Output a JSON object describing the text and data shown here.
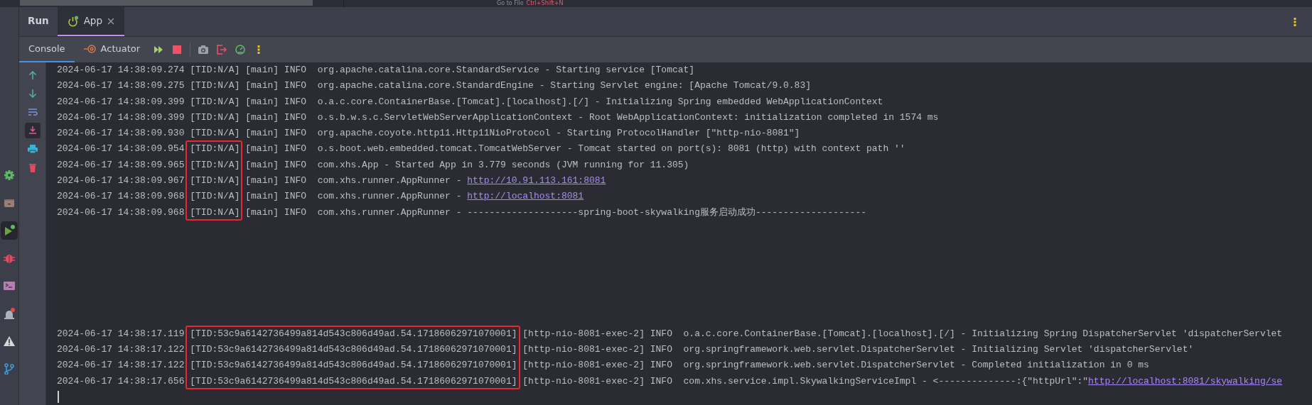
{
  "top_strip": {
    "hint": "Go to File",
    "shortcut": "Ctrl+Shift+N"
  },
  "tool_window_tabs": [
    {
      "label": "Run",
      "selected": false,
      "kind": "title"
    },
    {
      "label": "App",
      "selected": true,
      "kind": "run",
      "closable": true
    }
  ],
  "console_tabs": [
    {
      "label": "Console",
      "selected": true,
      "kind": "plain"
    },
    {
      "label": "Actuator",
      "selected": false,
      "kind": "actuator"
    }
  ],
  "toolbar": [
    {
      "kind": "rerun"
    },
    {
      "kind": "stop"
    },
    {
      "kind": "separator"
    },
    {
      "kind": "screenshot"
    },
    {
      "kind": "exit"
    },
    {
      "kind": "gauge"
    },
    {
      "kind": "more"
    }
  ],
  "left_tool_strip": [
    {
      "kind": "gear",
      "selected": false
    },
    {
      "kind": "folder",
      "selected": false
    },
    {
      "kind": "run",
      "selected": true
    },
    {
      "kind": "bug",
      "selected": false
    },
    {
      "kind": "terminal",
      "selected": false
    },
    {
      "kind": "alarm",
      "selected": false
    },
    {
      "kind": "warning",
      "selected": false
    },
    {
      "kind": "branch",
      "selected": false
    }
  ],
  "console_side_toolbar": [
    {
      "kind": "up",
      "selected": false
    },
    {
      "kind": "down",
      "selected": false
    },
    {
      "kind": "wrap",
      "selected": false
    },
    {
      "kind": "scroll-end",
      "selected": true
    },
    {
      "kind": "print",
      "selected": false
    },
    {
      "kind": "trash",
      "selected": false
    }
  ],
  "log_groups": [
    {
      "lines": [
        {
          "time": "2024-06-17 14:38:09.274",
          "tid": "[TID:N/A]",
          "message": " [main] INFO  org.apache.catalina.core.StandardService - Starting service [Tomcat]",
          "highlighted": false
        },
        {
          "time": "2024-06-17 14:38:09.275",
          "tid": "[TID:N/A]",
          "message": " [main] INFO  org.apache.catalina.core.StandardEngine - Starting Servlet engine: [Apache Tomcat/9.0.83]",
          "highlighted": false
        },
        {
          "time": "2024-06-17 14:38:09.399",
          "tid": "[TID:N/A]",
          "message": " [main] INFO  o.a.c.core.ContainerBase.[Tomcat].[localhost].[/] - Initializing Spring embedded WebApplicationContext",
          "highlighted": false
        },
        {
          "time": "2024-06-17 14:38:09.399",
          "tid": "[TID:N/A]",
          "message": " [main] INFO  o.s.b.w.s.c.ServletWebServerApplicationContext - Root WebApplicationContext: initialization completed in 1574 ms",
          "highlighted": false
        },
        {
          "time": "2024-06-17 14:38:09.930",
          "tid": "[TID:N/A]",
          "message": " [main] INFO  org.apache.coyote.http11.Http11NioProtocol - Starting ProtocolHandler [\"http-nio-8081\"]",
          "highlighted": false
        },
        {
          "time": "2024-06-17 14:38:09.954",
          "tid": "[TID:N/A]",
          "message": " [main] INFO  o.s.boot.web.embedded.tomcat.TomcatWebServer - Tomcat started on port(s): 8081 (http) with context path ''",
          "highlighted": true
        },
        {
          "time": "2024-06-17 14:38:09.965",
          "tid": "[TID:N/A]",
          "message": " [main] INFO  com.xhs.App - Started App in 3.779 seconds (JVM running for 11.305)",
          "highlighted": true
        },
        {
          "time": "2024-06-17 14:38:09.967",
          "tid": "[TID:N/A]",
          "message": " [main] INFO  com.xhs.runner.AppRunner - ",
          "link": "http://10.91.113.161:8081",
          "highlighted": true
        },
        {
          "time": "2024-06-17 14:38:09.968",
          "tid": "[TID:N/A]",
          "message": " [main] INFO  com.xhs.runner.AppRunner - ",
          "link": "http://localhost:8081",
          "highlighted": true
        },
        {
          "time": "2024-06-17 14:38:09.968",
          "tid": "[TID:N/A]",
          "message": " [main] INFO  com.xhs.runner.AppRunner - --------------------spring-boot-skywalking服务启动成功--------------------",
          "highlighted": true
        }
      ]
    },
    {
      "lines": [
        {
          "time": "2024-06-17 14:38:17.119",
          "tid": "[TID:53c9a6142736499a814d543c806d49ad.54.17186062971070001]",
          "message": " [http-nio-8081-exec-2] INFO  o.a.c.core.ContainerBase.[Tomcat].[localhost].[/] - Initializing Spring DispatcherServlet 'dispatcherServlet",
          "highlighted": true
        },
        {
          "time": "2024-06-17 14:38:17.122",
          "tid": "[TID:53c9a6142736499a814d543c806d49ad.54.17186062971070001]",
          "message": " [http-nio-8081-exec-2] INFO  org.springframework.web.servlet.DispatcherServlet - Initializing Servlet 'dispatcherServlet'",
          "highlighted": true
        },
        {
          "time": "2024-06-17 14:38:17.122",
          "tid": "[TID:53c9a6142736499a814d543c806d49ad.54.17186062971070001]",
          "message": " [http-nio-8081-exec-2] INFO  org.springframework.web.servlet.DispatcherServlet - Completed initialization in 0 ms",
          "highlighted": true
        },
        {
          "time": "2024-06-17 14:38:17.656",
          "tid": "[TID:53c9a6142736499a814d543c806d49ad.54.17186062971070001]",
          "message": " [http-nio-8081-exec-2] INFO  com.xhs.service.impl.SkywalkingServiceImpl - <--------------:{\"httpUrl\":\"",
          "link": "http://localhost:8081/skywalking/se",
          "highlighted": true
        }
      ]
    }
  ],
  "cursor": true
}
